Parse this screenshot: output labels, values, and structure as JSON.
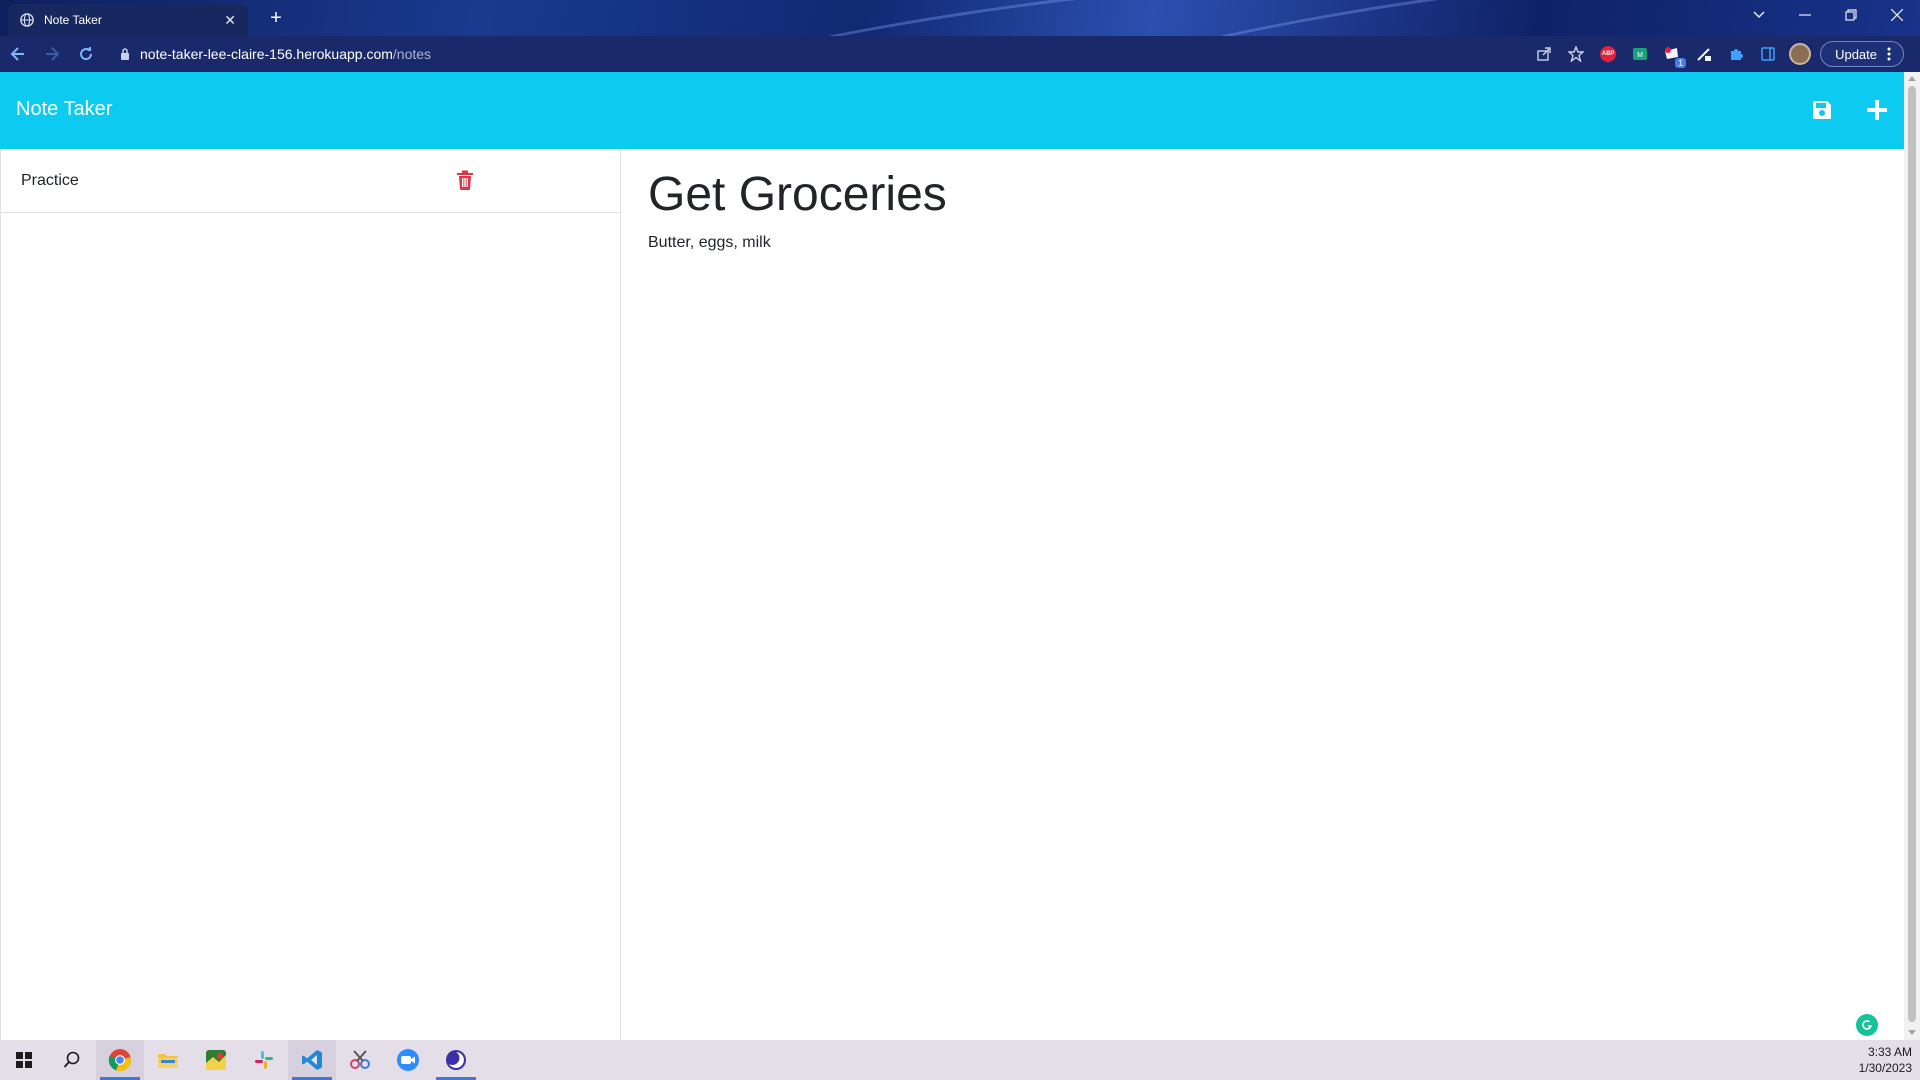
{
  "browser": {
    "tab_title": "Note Taker",
    "url_host": "note-taker-lee-claire-156.herokuapp.com",
    "url_path": "/notes",
    "update_label": "Update",
    "extensions": [
      "abp-icon",
      "teal-extension-icon",
      "badge-extension-icon",
      "pen-extension-icon",
      "puzzle-icon",
      "side-panel-icon"
    ],
    "extension_badge": "1",
    "abp_text": "ABP"
  },
  "app": {
    "brand": "Note Taker",
    "accent_color": "#0dcaf0",
    "delete_color": "#dc3545"
  },
  "notes": [
    {
      "title": "Practice"
    }
  ],
  "active_note": {
    "title": "Get Groceries",
    "text": "Butter, eggs, milk"
  },
  "taskbar": {
    "apps": [
      "windows-start-icon",
      "search-icon",
      "chrome-icon",
      "file-explorer-icon",
      "maps-icon",
      "slack-icon",
      "vscode-icon",
      "snip-tool-icon",
      "zoom-icon",
      "app-icon"
    ],
    "time": "3:33 AM",
    "date": "1/30/2023"
  }
}
